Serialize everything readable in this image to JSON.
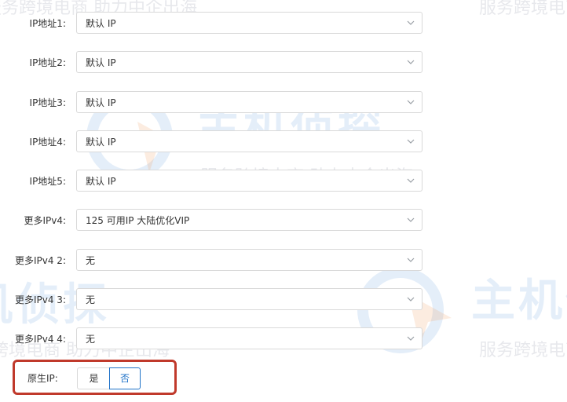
{
  "form": {
    "rows": [
      {
        "label": "IP地址1:",
        "value": "默认 IP"
      },
      {
        "label": "IP地址2:",
        "value": "默认 IP"
      },
      {
        "label": "IP地址3:",
        "value": "默认 IP"
      },
      {
        "label": "IP地址4:",
        "value": "默认 IP"
      },
      {
        "label": "IP地址5:",
        "value": "默认 IP"
      },
      {
        "label": "更多IPv4:",
        "value": "125 可用IP 大陆优化VIP"
      },
      {
        "label": "更多IPv4 2:",
        "value": "无"
      },
      {
        "label": "更多IPv4 3:",
        "value": "无"
      },
      {
        "label": "更多IPv4 4:",
        "value": "无"
      }
    ],
    "native_ip": {
      "label": "原生IP:",
      "options": [
        "是",
        "否"
      ],
      "selected": "否"
    }
  },
  "watermark": {
    "brand": "主机侦探",
    "slogan": "服务跨境电商 助力中企出海"
  },
  "colors": {
    "accent": "#1f72c8",
    "highlight_box": "#c0392b",
    "border": "#d9d9d9"
  },
  "icons": [
    "chevron-down-icon",
    "watermark-logo-icon"
  ]
}
